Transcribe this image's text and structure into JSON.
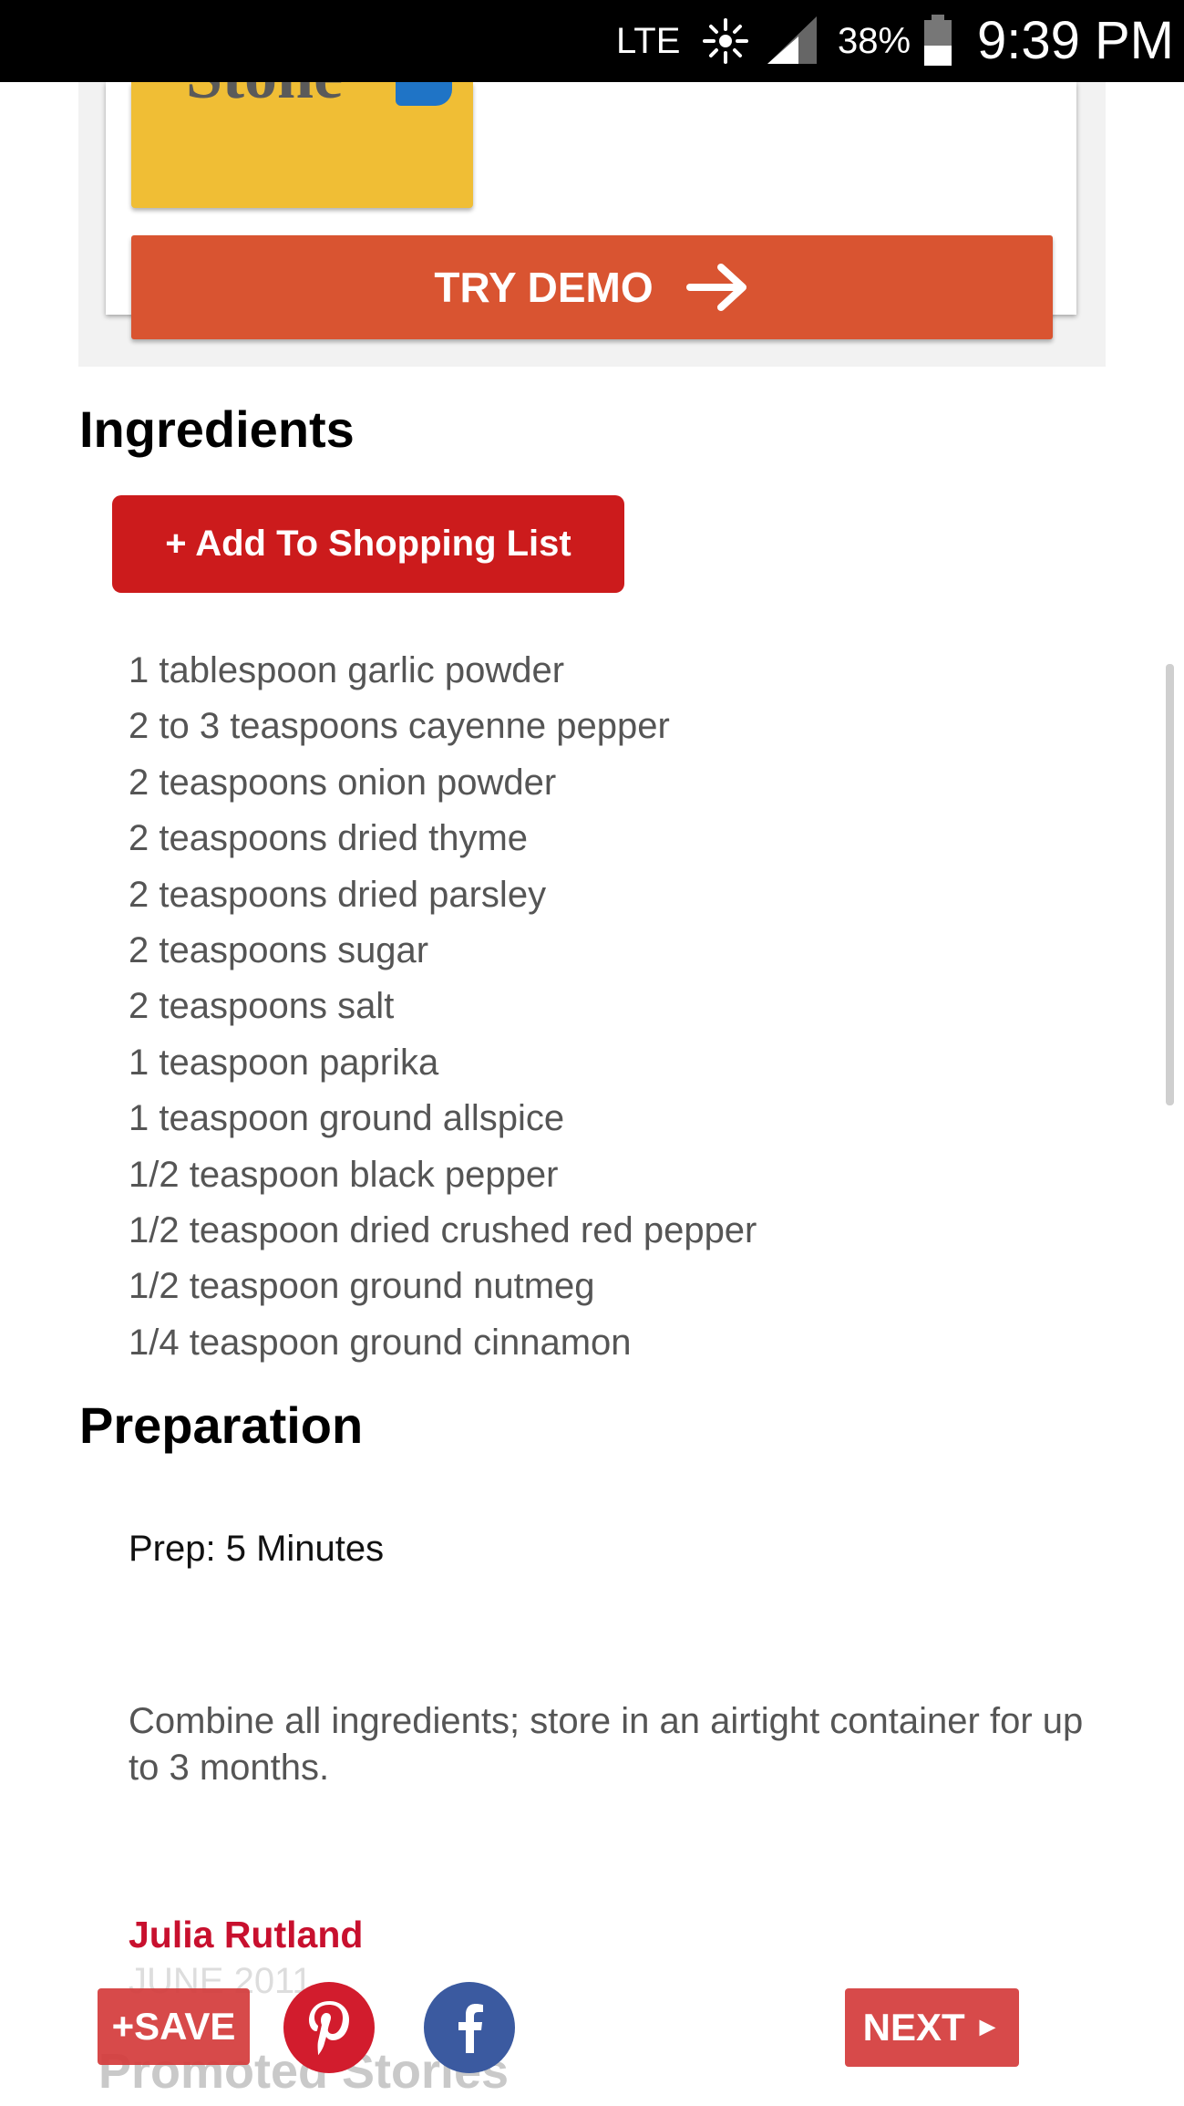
{
  "status_bar": {
    "network": "LTE",
    "battery_percent": "38%",
    "time": "9:39 PM",
    "icons": [
      "sync-icon",
      "signal-icon",
      "battery-icon"
    ]
  },
  "ad": {
    "product_text": "Stone",
    "cta_label": "TRY DEMO",
    "cta_color": "#d95431",
    "product_bg_color": "#f0be35"
  },
  "ingredients": {
    "heading": "Ingredients",
    "add_button_label": "+ Add To Shopping List",
    "items": [
      "1 tablespoon garlic powder",
      "2 to 3 teaspoons cayenne pepper",
      "2 teaspoons onion powder",
      "2 teaspoons dried thyme",
      "2 teaspoons dried parsley",
      "2 teaspoons sugar",
      "2 teaspoons salt",
      "1 teaspoon paprika",
      "1 teaspoon ground allspice",
      "1/2 teaspoon black pepper",
      "1/2 teaspoon dried crushed red pepper",
      "1/2 teaspoon ground nutmeg",
      "1/4 teaspoon ground cinnamon"
    ]
  },
  "preparation": {
    "heading": "Preparation",
    "prep_time": "Prep: 5 Minutes",
    "instructions": "Combine all ingredients; store in an airtight container for up to 3 months."
  },
  "author": {
    "name": "Julia Rutland",
    "date": "JUNE 2011"
  },
  "promoted": {
    "heading": "Promoted Stories"
  },
  "actions": {
    "save_label": "+SAVE",
    "next_label": "NEXT",
    "next_arrow": "►",
    "accent_color": "#d43d3d",
    "pinterest_color": "#d21c2d",
    "facebook_color": "#3b5aa0"
  }
}
